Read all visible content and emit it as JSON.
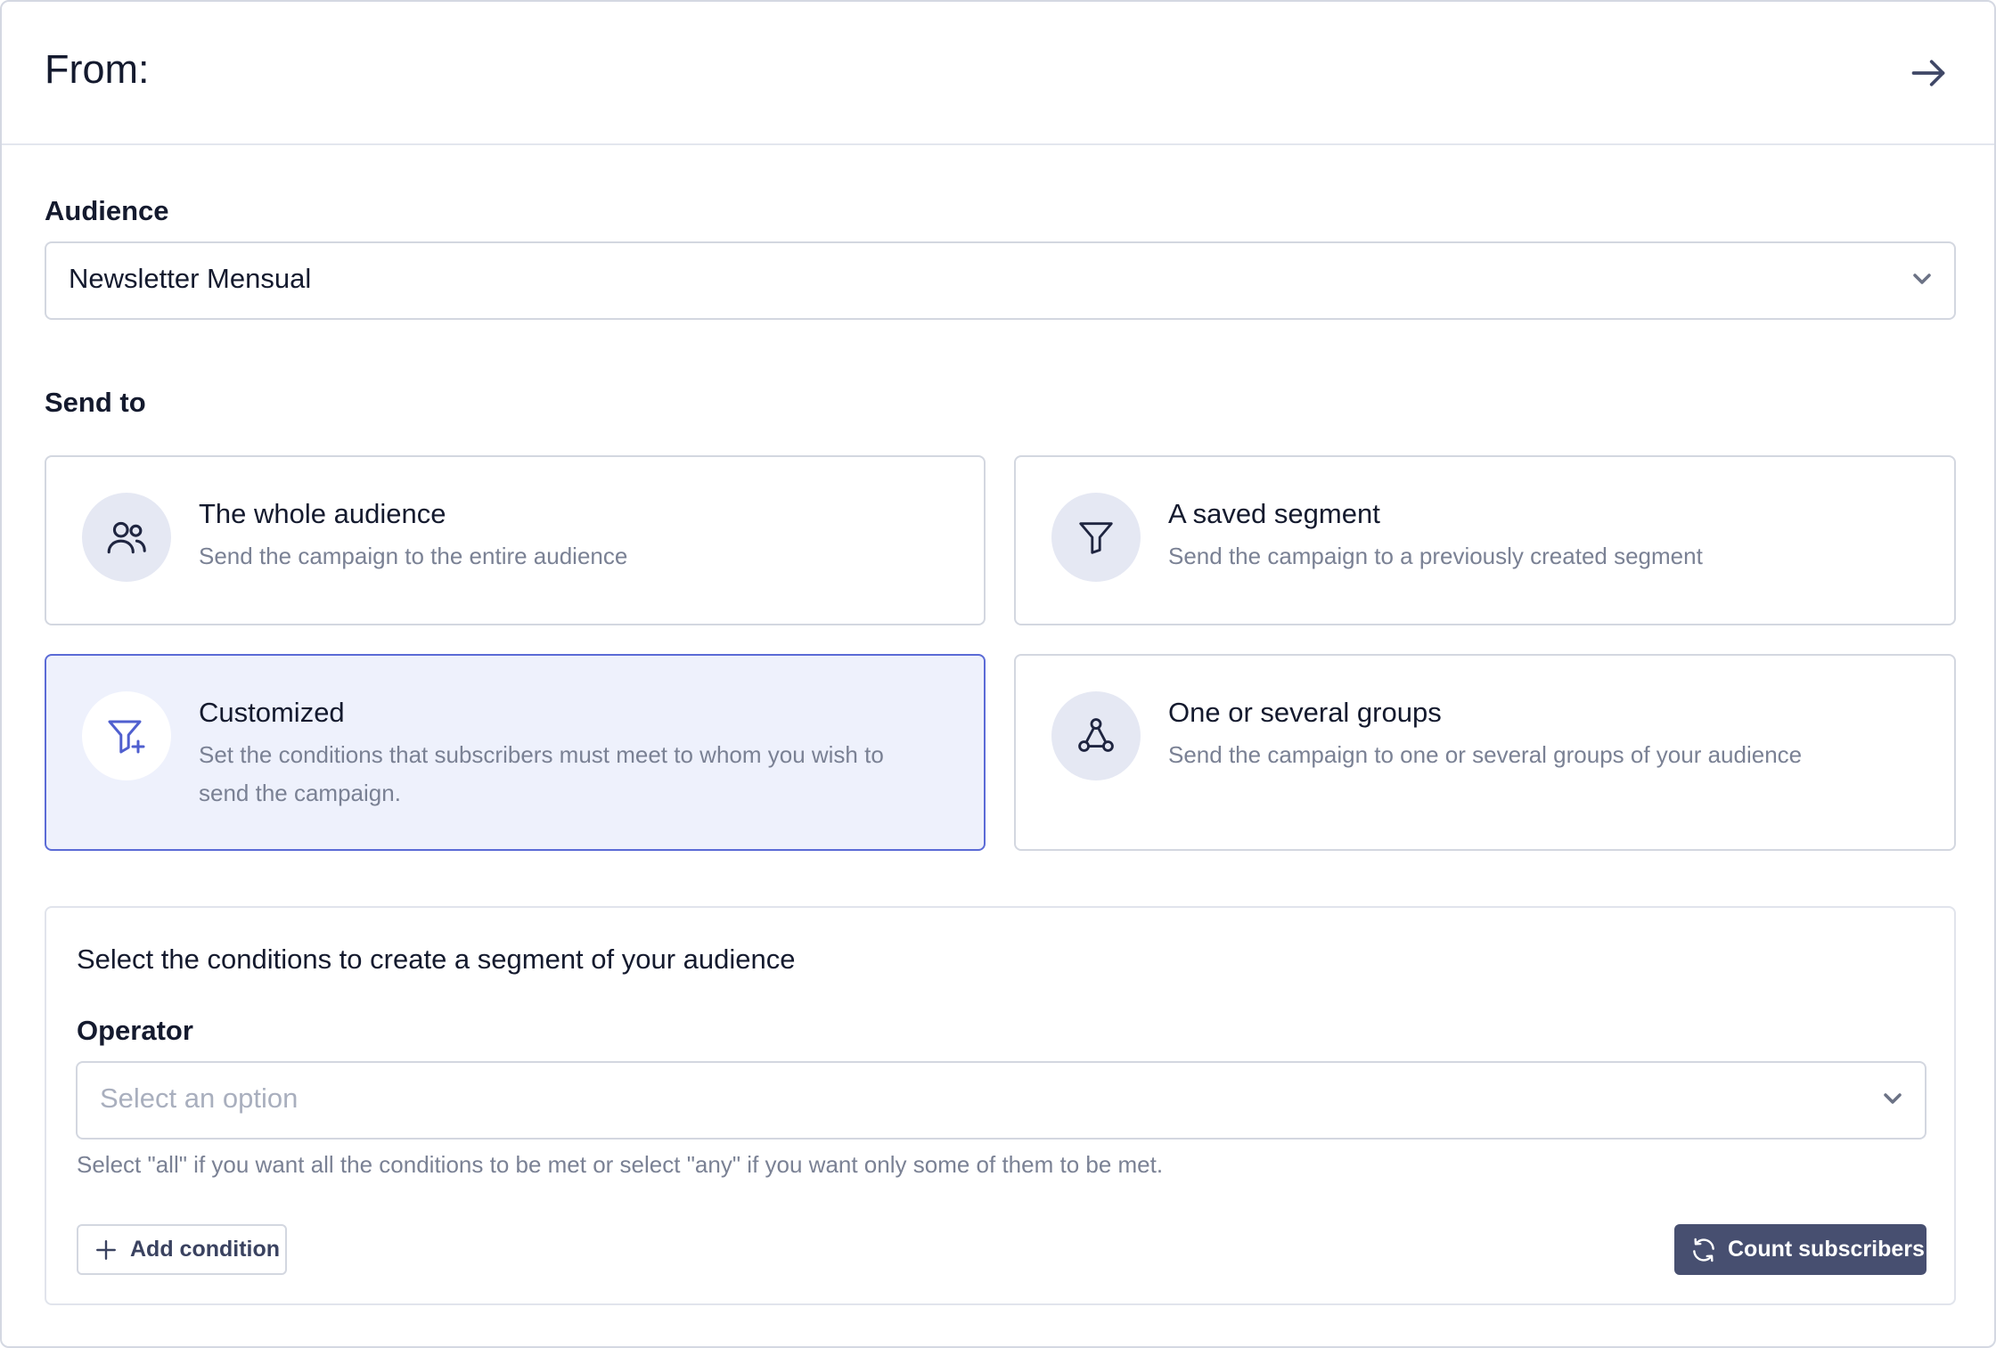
{
  "header": {
    "title": "From:",
    "next_icon": "arrow-right-icon"
  },
  "audience": {
    "label": "Audience",
    "selected": "Newsletter Mensual"
  },
  "send_to": {
    "label": "Send to",
    "selected_option": "Customized",
    "options": [
      {
        "title": "The whole audience",
        "description": "Send the campaign to the entire audience",
        "icon": "users-icon"
      },
      {
        "title": "A saved segment",
        "description": "Send the campaign to a previously created segment",
        "icon": "funnel-icon"
      },
      {
        "title": "Customized",
        "description": "Set the conditions that subscribers must meet to whom you wish to send the campaign.",
        "icon": "funnel-plus-icon"
      },
      {
        "title": "One or several groups",
        "description": "Send the campaign to one or several groups of your audience",
        "icon": "group-nodes-icon"
      }
    ]
  },
  "conditions": {
    "title": "Select the conditions to create a segment of your audience",
    "operator_label": "Operator",
    "operator_placeholder": "Select an option",
    "help_text": "Select \"all\" if you want all the conditions to be met or select \"any\" if you want only some of them to be met.",
    "add_button": "Add condition",
    "count_button": "Count subscribers"
  },
  "colors": {
    "accent": "#5b6bd6",
    "selected_bg": "#eef1fc",
    "primary_button": "#474f70",
    "icon_circle": "#e5e8f3"
  }
}
